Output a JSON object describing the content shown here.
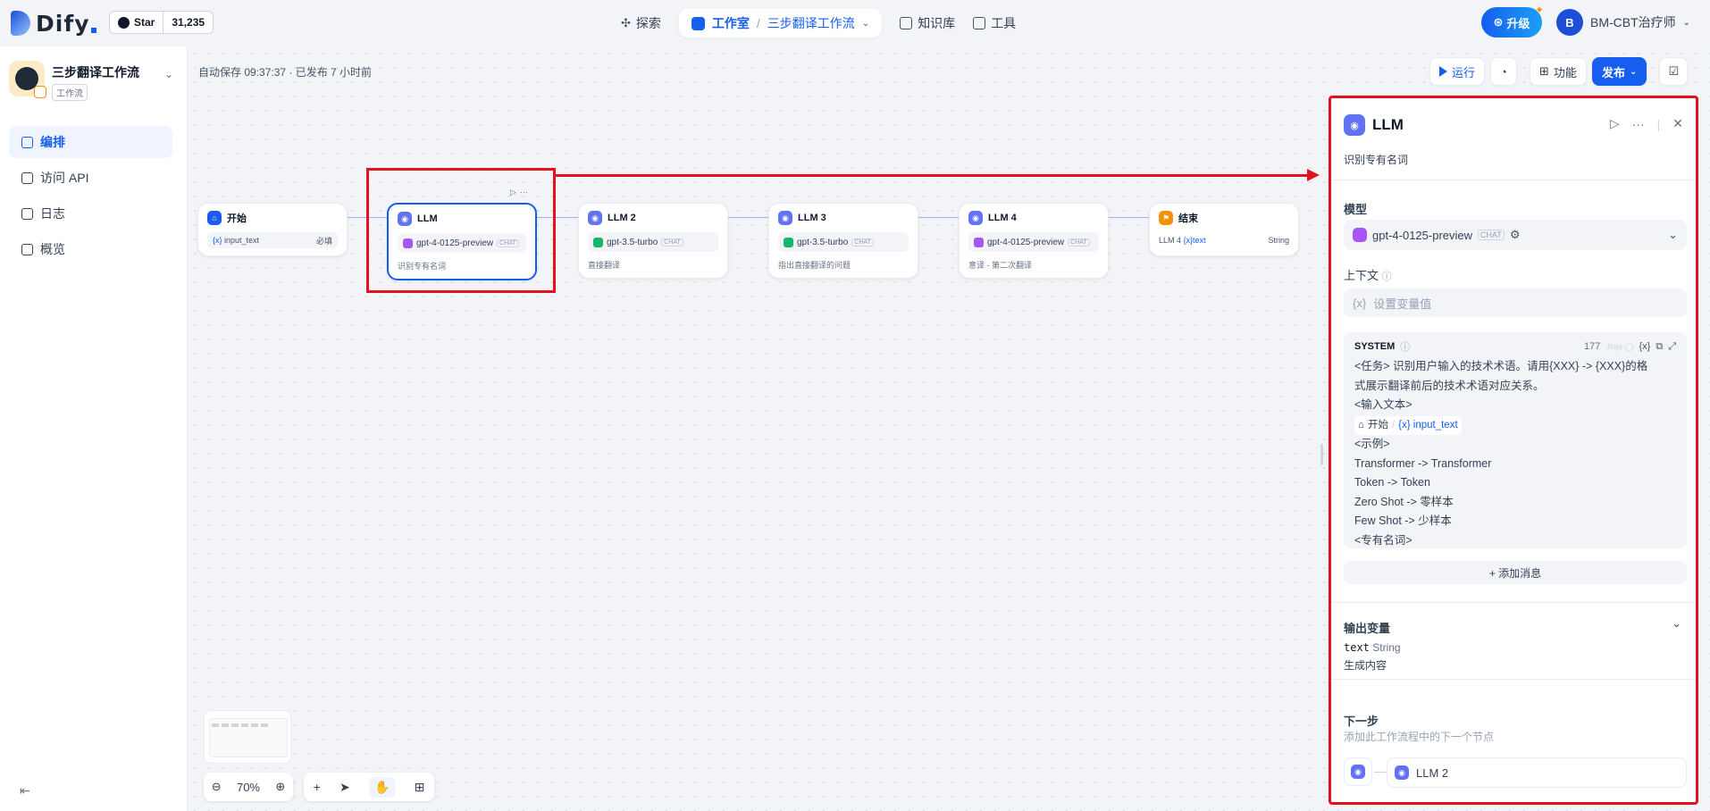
{
  "topbar": {
    "logo": "Dify",
    "github": {
      "star_label": "Star",
      "count": "31,235"
    },
    "nav": {
      "explore": "探索",
      "studio": "工作室",
      "app_name": "三步翻译工作流",
      "knowledge": "知识库",
      "tools": "工具"
    },
    "upgrade_label": "升级",
    "user": {
      "initial": "B",
      "name": "BM-CBT治疗师"
    }
  },
  "sidebar": {
    "app_name": "三步翻译工作流",
    "app_type": "工作流",
    "items": [
      {
        "label": "编排",
        "icon": "layout-icon",
        "active": true
      },
      {
        "label": "访问 API",
        "icon": "terminal-icon",
        "active": false
      },
      {
        "label": "日志",
        "icon": "file-list-icon",
        "active": false
      },
      {
        "label": "概览",
        "icon": "bar-chart-icon",
        "active": false
      }
    ]
  },
  "canvas": {
    "autosave_text": "自动保存 09:37:37 · 已发布 7 小时前",
    "toolbar": {
      "run_label": "运行",
      "features_label": "功能",
      "publish_label": "发布"
    },
    "nodes": [
      {
        "title": "开始",
        "var_name": "input_text",
        "var_meta": "必填"
      },
      {
        "title": "LLM",
        "model": "gpt-4-0125-preview",
        "tag": "CHAT",
        "desc": "识别专有名词"
      },
      {
        "title": "LLM 2",
        "model": "gpt-3.5-turbo",
        "tag": "CHAT",
        "desc": "直接翻译"
      },
      {
        "title": "LLM 3",
        "model": "gpt-3.5-turbo",
        "tag": "CHAT",
        "desc": "指出直接翻译的问题"
      },
      {
        "title": "LLM 4",
        "model": "gpt-4-0125-preview",
        "tag": "CHAT",
        "desc": "意译 - 第二次翻译"
      },
      {
        "title": "结束",
        "var_src": "LLM 4",
        "var_name": "text",
        "var_type": "String"
      }
    ],
    "zoom": "70%"
  },
  "panel": {
    "title": "LLM",
    "description": "识别专有名词",
    "model_label": "模型",
    "model_name": "gpt-4-0125-preview",
    "model_tag": "CHAT",
    "context_label": "上下文",
    "context_placeholder": "设置变量值",
    "system": {
      "label": "SYSTEM",
      "count": "177",
      "jinja": "Jinja",
      "lines": [
        "<任务> 识别用户输入的技术术语。请用{XXX} -> {XXX}的格",
        "式展示翻译前后的技术术语对应关系。",
        "<输入文本>"
      ],
      "var_chip": {
        "node": "开始",
        "sep": "/",
        "var": "{x} input_text"
      },
      "lines_after": [
        "<示例>",
        "Transformer -> Transformer",
        "Token -> Token",
        "Zero Shot -> 零样本",
        "Few Shot -> 少样本",
        "<专有名词>"
      ]
    },
    "add_message": "+ 添加消息",
    "output_label": "输出变量",
    "output_var": "text",
    "output_type": "String",
    "output_desc": "生成内容",
    "next_label": "下一步",
    "next_hint": "添加此工作流程中的下一个节点",
    "next_node": "LLM 2"
  },
  "colors": {
    "accent": "#155eef",
    "annotation_red": "#e1141e"
  }
}
